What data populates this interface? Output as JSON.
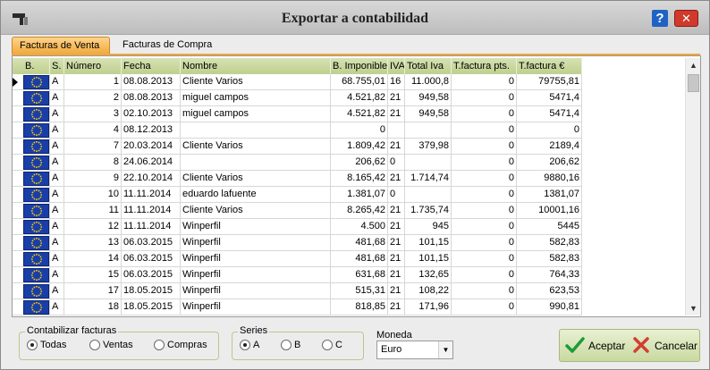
{
  "window": {
    "title": "Exportar a contabilidad",
    "help_label": "?",
    "close_label": "✕"
  },
  "tabs": [
    {
      "label": "Facturas de Venta",
      "active": true
    },
    {
      "label": "Facturas de Compra",
      "active": false
    }
  ],
  "table": {
    "columns": [
      "B.",
      "S.",
      "Número",
      "Fecha",
      "Nombre",
      "B. Imponible",
      "IVA",
      "Total Iva",
      "T.factura pts.",
      "T.factura €"
    ],
    "rows": [
      {
        "serie": "A",
        "numero": "1",
        "fecha": "08.08.2013",
        "nombre": "Cliente Varios",
        "base": "68.755,01",
        "iva": "16",
        "total_iva": "11.000,8",
        "pts": "0",
        "eur": "79755,81"
      },
      {
        "serie": "A",
        "numero": "2",
        "fecha": "08.08.2013",
        "nombre": "miguel campos",
        "base": "4.521,82",
        "iva": "21",
        "total_iva": "949,58",
        "pts": "0",
        "eur": "5471,4"
      },
      {
        "serie": "A",
        "numero": "3",
        "fecha": "02.10.2013",
        "nombre": "miguel campos",
        "base": "4.521,82",
        "iva": "21",
        "total_iva": "949,58",
        "pts": "0",
        "eur": "5471,4"
      },
      {
        "serie": "A",
        "numero": "4",
        "fecha": "08.12.2013",
        "nombre": "",
        "base": "0",
        "iva": "",
        "total_iva": "",
        "pts": "0",
        "eur": "0"
      },
      {
        "serie": "A",
        "numero": "7",
        "fecha": "20.03.2014",
        "nombre": "Cliente Varios",
        "base": "1.809,42",
        "iva": "21",
        "total_iva": "379,98",
        "pts": "0",
        "eur": "2189,4"
      },
      {
        "serie": "A",
        "numero": "8",
        "fecha": "24.06.2014",
        "nombre": "",
        "base": "206,62",
        "iva": "0",
        "total_iva": "",
        "pts": "0",
        "eur": "206,62"
      },
      {
        "serie": "A",
        "numero": "9",
        "fecha": "22.10.2014",
        "nombre": "Cliente Varios",
        "base": "8.165,42",
        "iva": "21",
        "total_iva": "1.714,74",
        "pts": "0",
        "eur": "9880,16"
      },
      {
        "serie": "A",
        "numero": "10",
        "fecha": "11.11.2014",
        "nombre": "eduardo lafuente",
        "base": "1.381,07",
        "iva": "0",
        "total_iva": "",
        "pts": "0",
        "eur": "1381,07"
      },
      {
        "serie": "A",
        "numero": "11",
        "fecha": "11.11.2014",
        "nombre": "Cliente Varios",
        "base": "8.265,42",
        "iva": "21",
        "total_iva": "1.735,74",
        "pts": "0",
        "eur": "10001,16"
      },
      {
        "serie": "A",
        "numero": "12",
        "fecha": "11.11.2014",
        "nombre": "Winperfil",
        "base": "4.500",
        "iva": "21",
        "total_iva": "945",
        "pts": "0",
        "eur": "5445"
      },
      {
        "serie": "A",
        "numero": "13",
        "fecha": "06.03.2015",
        "nombre": "Winperfil",
        "base": "481,68",
        "iva": "21",
        "total_iva": "101,15",
        "pts": "0",
        "eur": "582,83"
      },
      {
        "serie": "A",
        "numero": "14",
        "fecha": "06.03.2015",
        "nombre": "Winperfil",
        "base": "481,68",
        "iva": "21",
        "total_iva": "101,15",
        "pts": "0",
        "eur": "582,83"
      },
      {
        "serie": "A",
        "numero": "15",
        "fecha": "06.03.2015",
        "nombre": "Winperfil",
        "base": "631,68",
        "iva": "21",
        "total_iva": "132,65",
        "pts": "0",
        "eur": "764,33"
      },
      {
        "serie": "A",
        "numero": "17",
        "fecha": "18.05.2015",
        "nombre": "Winperfil",
        "base": "515,31",
        "iva": "21",
        "total_iva": "108,22",
        "pts": "0",
        "eur": "623,53"
      },
      {
        "serie": "A",
        "numero": "18",
        "fecha": "18.05.2015",
        "nombre": "Winperfil",
        "base": "818,85",
        "iva": "21",
        "total_iva": "171,96",
        "pts": "0",
        "eur": "990,81"
      }
    ]
  },
  "contabilizar": {
    "label": "Contabilizar facturas",
    "options": [
      "Todas",
      "Ventas",
      "Compras"
    ],
    "selected": "Todas"
  },
  "series": {
    "label": "Series",
    "options": [
      "A",
      "B",
      "C"
    ],
    "selected": "A"
  },
  "moneda": {
    "label": "Moneda",
    "value": "Euro"
  },
  "buttons": {
    "accept": "Aceptar",
    "cancel": "Cancelar"
  },
  "colors": {
    "header_green": "#bfd08f",
    "tab_orange": "#f0a83a",
    "flag_blue": "#1a3ea8",
    "accept_check": "#1f9a3a",
    "cancel_x": "#d2402f"
  }
}
